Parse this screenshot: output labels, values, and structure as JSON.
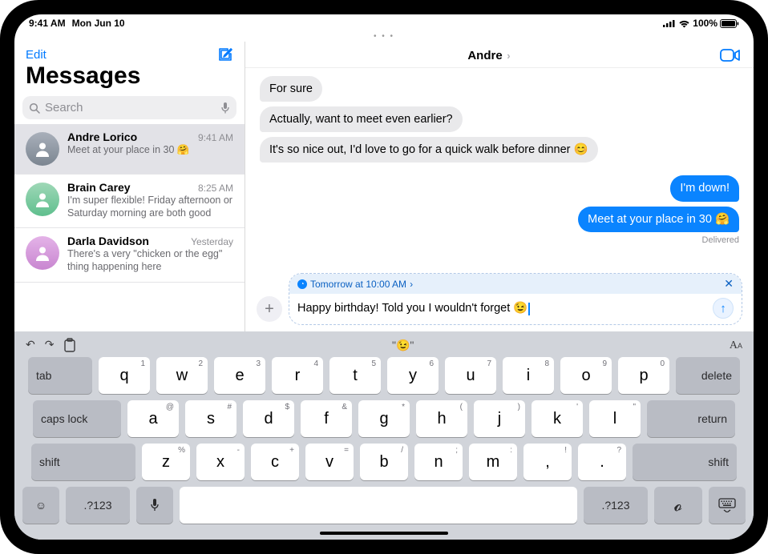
{
  "statusbar": {
    "time": "9:41 AM",
    "date": "Mon Jun 10",
    "battery_text": "100%",
    "wifi_icon": "wifi",
    "battery_icon": "battery"
  },
  "sidebar": {
    "edit_label": "Edit",
    "title": "Messages",
    "search_placeholder": "Search",
    "conversations": [
      {
        "id": "andre",
        "name": "Andre Lorico",
        "time": "9:41 AM",
        "preview": "Meet at your place in 30 🤗",
        "selected": true
      },
      {
        "id": "brain",
        "name": "Brain Carey",
        "time": "8:25 AM",
        "preview": "I'm super flexible! Friday afternoon or Saturday morning are both good",
        "selected": false
      },
      {
        "id": "darla",
        "name": "Darla Davidson",
        "time": "Yesterday",
        "preview": "There's a very \"chicken or the egg\" thing happening here",
        "selected": false
      }
    ]
  },
  "chat": {
    "header_name": "Andre",
    "messages": [
      {
        "dir": "in",
        "text": "For sure"
      },
      {
        "dir": "in",
        "text": "Actually, want to meet even earlier?"
      },
      {
        "dir": "in",
        "text": "It's so nice out, I'd love to go for a quick walk before dinner 😊"
      },
      {
        "dir": "out",
        "text": "I'm down!"
      },
      {
        "dir": "out",
        "text": "Meet at your place in 30 🤗"
      }
    ],
    "delivered_label": "Delivered"
  },
  "composer": {
    "schedule_text": "Tomorrow at 10:00 AM",
    "draft_text": "Happy birthday! Told you I wouldn't forget 😉"
  },
  "keyboard": {
    "suggestion": "\"😉\"",
    "rows": {
      "r1": [
        {
          "main": "q",
          "sup": "1"
        },
        {
          "main": "w",
          "sup": "2"
        },
        {
          "main": "e",
          "sup": "3"
        },
        {
          "main": "r",
          "sup": "4"
        },
        {
          "main": "t",
          "sup": "5"
        },
        {
          "main": "y",
          "sup": "6"
        },
        {
          "main": "u",
          "sup": "7"
        },
        {
          "main": "i",
          "sup": "8"
        },
        {
          "main": "o",
          "sup": "9"
        },
        {
          "main": "p",
          "sup": "0"
        }
      ],
      "r2": [
        {
          "main": "a",
          "sup": "@"
        },
        {
          "main": "s",
          "sup": "#"
        },
        {
          "main": "d",
          "sup": "$"
        },
        {
          "main": "f",
          "sup": "&"
        },
        {
          "main": "g",
          "sup": "*"
        },
        {
          "main": "h",
          "sup": "("
        },
        {
          "main": "j",
          "sup": ")"
        },
        {
          "main": "k",
          "sup": "'"
        },
        {
          "main": "l",
          "sup": "\""
        }
      ],
      "r3": [
        {
          "main": "z",
          "sup": "%"
        },
        {
          "main": "x",
          "sup": "-"
        },
        {
          "main": "c",
          "sup": "+"
        },
        {
          "main": "v",
          "sup": "="
        },
        {
          "main": "b",
          "sup": "/"
        },
        {
          "main": "n",
          "sup": ";"
        },
        {
          "main": "m",
          "sup": ":"
        },
        {
          "main": ",",
          "sup": "!"
        },
        {
          "main": ".",
          "sup": "?"
        }
      ]
    },
    "tab_label": "tab",
    "delete_label": "delete",
    "caps_label": "caps lock",
    "return_label": "return",
    "shift_label": "shift",
    "numkey_label": ".?123"
  }
}
